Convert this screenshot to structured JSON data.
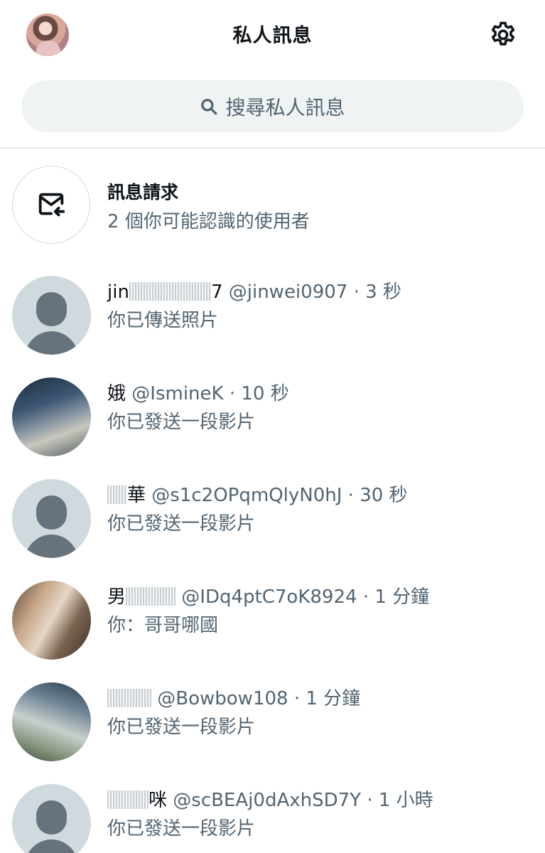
{
  "header": {
    "title": "私人訊息"
  },
  "search": {
    "placeholder": "搜尋私人訊息"
  },
  "message_requests": {
    "title": "訊息請求",
    "subtitle": "2 個你可能認識的使用者"
  },
  "conversations": [
    {
      "name": "jin",
      "name_tail": "7",
      "handle": "@jinwei0907",
      "time": "· 3 秒",
      "preview": "你已傳送照片",
      "avatar": "default"
    },
    {
      "name": "",
      "name_tail": "娥",
      "handle": "@IsmineK",
      "time": "· 10 秒",
      "preview": "你已發送一段影片",
      "avatar": "photo"
    },
    {
      "name": "",
      "name_tail": "華",
      "handle": "@s1c2OPqmQlyN0hJ",
      "time": "· 30 秒",
      "preview": "你已發送一段影片",
      "avatar": "default"
    },
    {
      "name": "",
      "name_tail": "男",
      "handle": "@IDq4ptC7oK8924",
      "time": "· 1 分鐘",
      "preview": "你：哥哥哪國",
      "avatar": "photo"
    },
    {
      "name": "",
      "name_tail": "",
      "handle": "@Bowbow108",
      "time": "· 1 分鐘",
      "preview": "你已發送一段影片",
      "avatar": "photo"
    },
    {
      "name": "",
      "name_tail": "咪",
      "handle": "@scBEAj0dAxhSD7Y",
      "time": "· 1 小時",
      "preview": "你已發送一段影片",
      "avatar": "default"
    }
  ]
}
